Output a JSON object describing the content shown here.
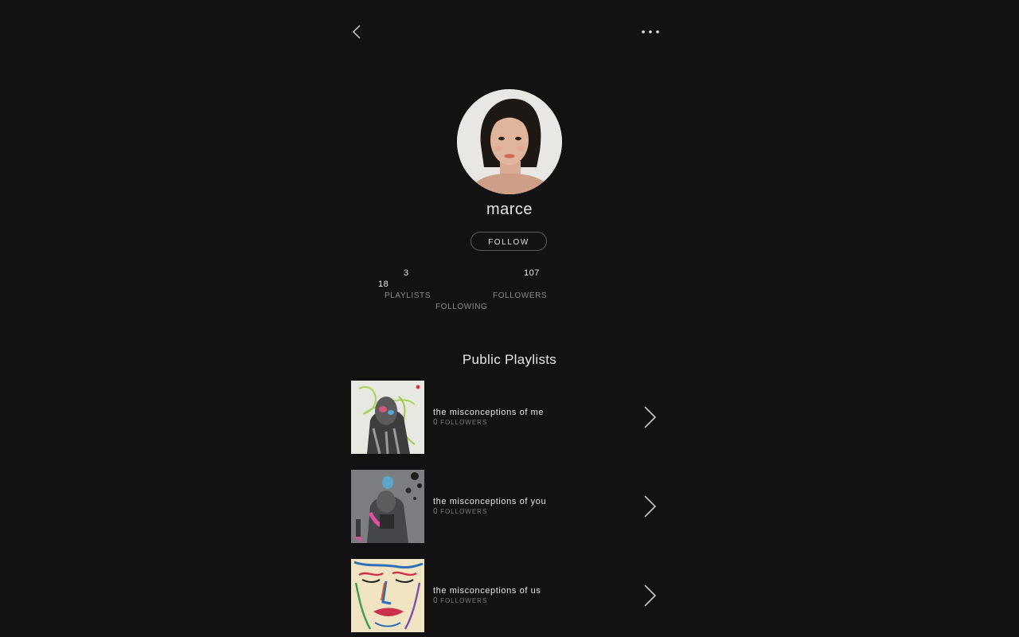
{
  "header": {
    "back_icon": "chevron-left-icon",
    "more_icon": "ellipsis-icon"
  },
  "profile": {
    "username": "marce",
    "follow_label": "FOLLOW",
    "avatar_icon": "avatar-photo"
  },
  "stats": {
    "playlists": {
      "count": "3",
      "label": "PLAYLISTS"
    },
    "following": {
      "count": "18",
      "label": "FOLLOWING"
    },
    "followers": {
      "count": "107",
      "label": "FOLLOWERS"
    }
  },
  "section": {
    "title": "Public Playlists"
  },
  "playlists": [
    {
      "name": "the misconceptions of me",
      "followers_count": "0",
      "followers_label": "FOLLOWERS"
    },
    {
      "name": "the misconceptions of you",
      "followers_count": "0",
      "followers_label": "FOLLOWERS"
    },
    {
      "name": "the misconceptions of us",
      "followers_count": "0",
      "followers_label": "FOLLOWERS"
    }
  ],
  "colors": {
    "background": "#121212",
    "text_primary": "#e6e6e6",
    "text_secondary": "#8a8a8a"
  }
}
